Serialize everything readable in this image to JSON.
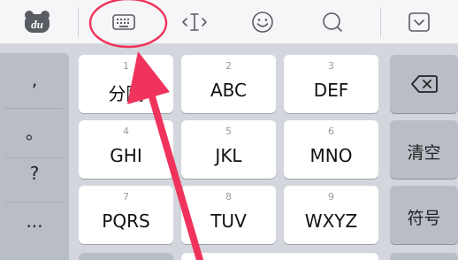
{
  "toolbar": {
    "icons": [
      "du-logo-icon",
      "keyboard-icon",
      "cursor-move-icon",
      "emoji-icon",
      "search-icon",
      "collapse-keyboard-icon"
    ],
    "logo_text": "du"
  },
  "punctuation": [
    ",",
    "。",
    "?",
    "..."
  ],
  "keys": [
    {
      "num": "1",
      "label": "分隔"
    },
    {
      "num": "2",
      "label": "ABC"
    },
    {
      "num": "3",
      "label": "DEF"
    },
    {
      "num": "4",
      "label": "GHI"
    },
    {
      "num": "5",
      "label": "JKL"
    },
    {
      "num": "6",
      "label": "MNO"
    },
    {
      "num": "7",
      "label": "PQRS"
    },
    {
      "num": "8",
      "label": "TUV"
    },
    {
      "num": "9",
      "label": "WXYZ"
    }
  ],
  "right_keys": {
    "clear": "清空",
    "symbols": "符号"
  },
  "colors": {
    "annotation": "#f0335c",
    "keyboard_bg": "#d3d6dd",
    "function_key": "#b9bdc6"
  }
}
